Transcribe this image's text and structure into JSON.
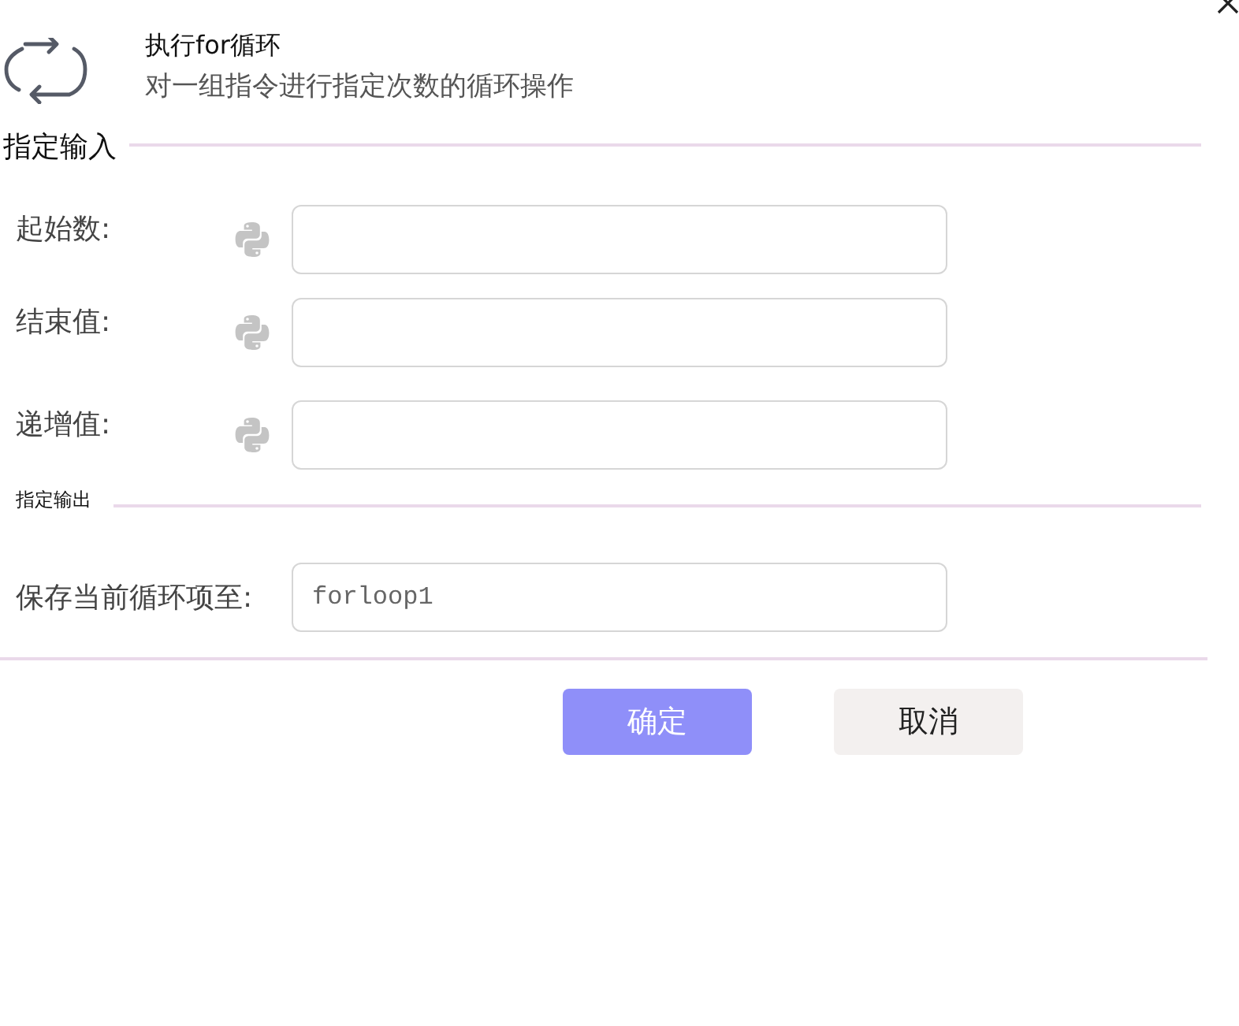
{
  "header": {
    "title": "执行for循环",
    "description": "对一组指令进行指定次数的循环操作"
  },
  "sections": [
    {
      "title": "指定输入",
      "kind": "input",
      "fields": [
        {
          "label": "起始数:",
          "kind": "expression"
        },
        {
          "label": "结束值:",
          "kind": "expression"
        },
        {
          "label": "递增值:",
          "kind": "expression"
        }
      ]
    },
    {
      "title": "指定输出",
      "kind": "output",
      "fields": [
        {
          "label": "保存当前循环项至:",
          "kind": "variable",
          "value": "forloop1"
        }
      ]
    }
  ],
  "buttons": [
    {
      "label": "确定",
      "kind": "primary"
    },
    {
      "label": "取消",
      "kind": "secondary"
    }
  ]
}
